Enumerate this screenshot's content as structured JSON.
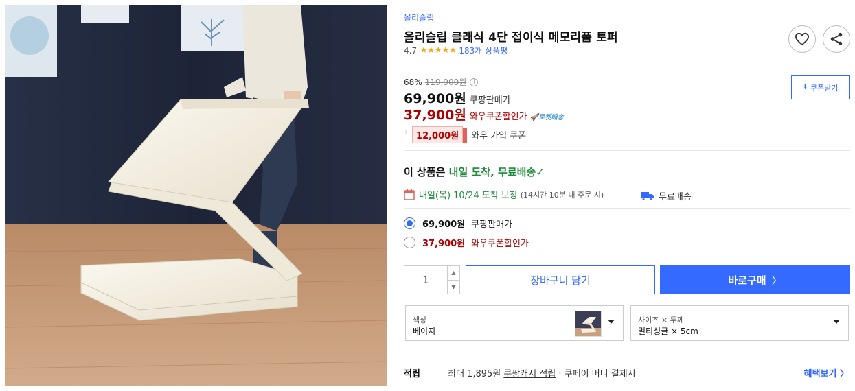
{
  "product": {
    "image_alt": "product photo: woman unfolding a 4-fold white memory foam topper on a wooden floor",
    "brand": "올리슬립",
    "title": "올리슬립 클래식 4단 접이식 메모리폼 토퍼",
    "rating": "4.7",
    "stars": "★★★★★",
    "review_count": "183개 상품평"
  },
  "pricing": {
    "discount_rate": "68%",
    "original_price": "119,900원",
    "info_glyph": "i",
    "seller_price": "69,900원",
    "seller_price_label": "쿠팡판매가",
    "wow_price": "37,900원",
    "wow_price_label": "와우쿠폰할인가",
    "rocket_label": "🚀로켓배송",
    "coupon_amount": "12,000원",
    "coupon_desc": "와우 가입 쿠폰",
    "coupon_button": "쿠폰받기",
    "coupon_button_icon": "⬇"
  },
  "delivery": {
    "headline_prefix": "이 상품은 ",
    "headline_green": "내일 도착, 무료배송",
    "headline_check": "✓",
    "date_text": "내일(목) 10/24 도착 보장",
    "date_note": "(14시간 10분 내 주문 시)",
    "free_shipping": "무료배송"
  },
  "options": [
    {
      "price": "69,900원",
      "label": "쿠팡판매가",
      "selected": true
    },
    {
      "price": "37,900원",
      "label": "와우쿠폰할인가",
      "selected": false
    }
  ],
  "purchase": {
    "quantity": "1",
    "cart_label": "장바구니 담기",
    "buy_label": "바로구매",
    "buy_chevron": "〉",
    "up_glyph": "▲",
    "down_glyph": "▼"
  },
  "selectors": {
    "color_caption": "색상",
    "color_value": "베이지",
    "size_caption": "사이즈 × 두께",
    "size_value": "멀티싱글 × 5cm"
  },
  "points": {
    "title": "적립",
    "text_before": "최대 1,895원 ",
    "text_link": "쿠팡캐시 적립",
    "text_after": " · 쿠페이 머니 결제시",
    "benefit_link": "혜택보기 〉"
  },
  "colors": {
    "accent": "#346aff",
    "sale_red": "#ae0000",
    "delivery_green": "#1c8a3a",
    "star": "#f6a71a"
  }
}
